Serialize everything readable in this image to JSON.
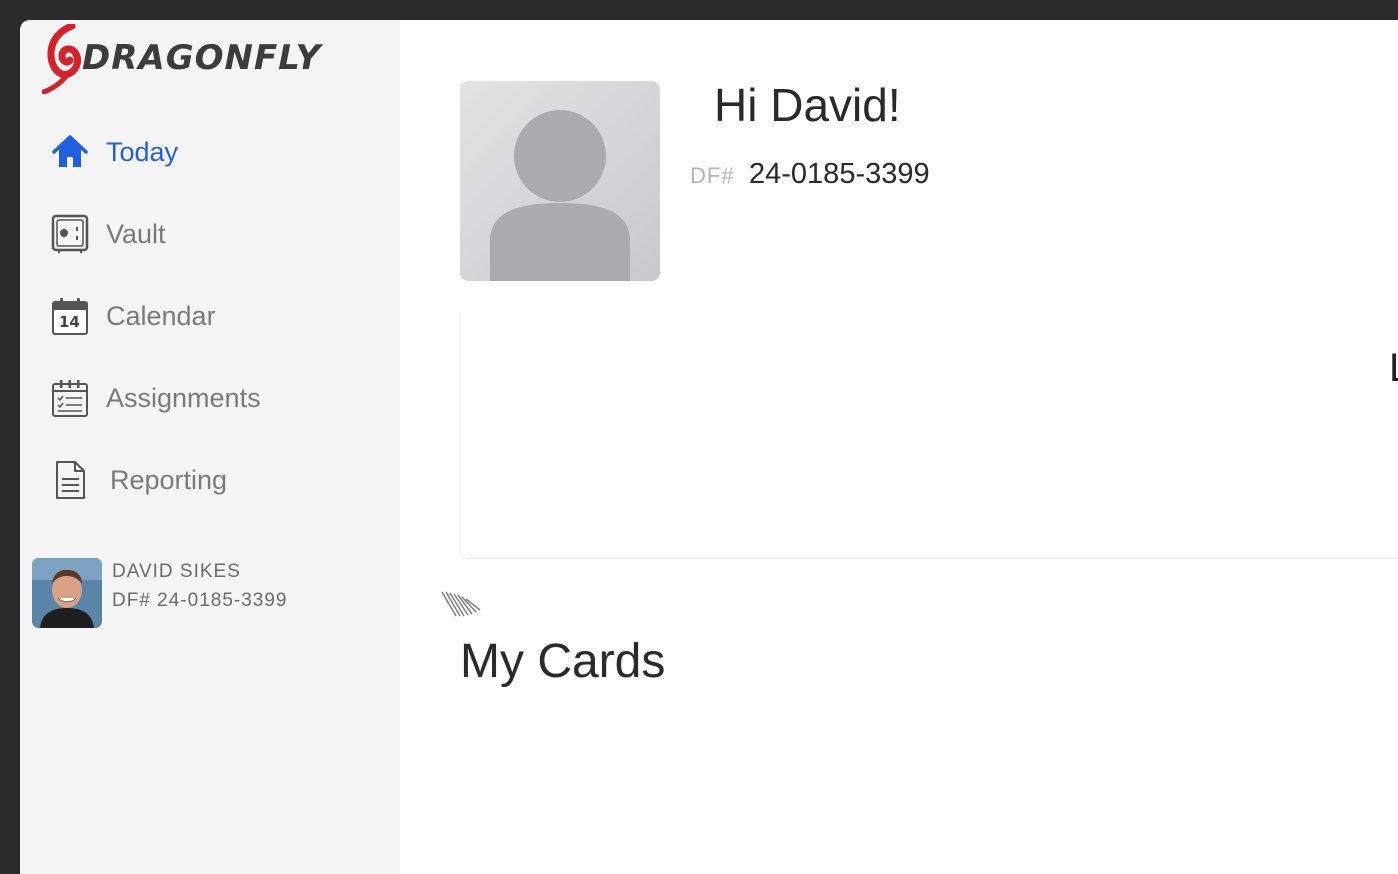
{
  "app": {
    "logo_text": "DRAGONFLY",
    "accent_color": "#2260d8",
    "logo_red": "#d8202a"
  },
  "sidebar": {
    "items": [
      {
        "label": "Today",
        "icon": "home-icon",
        "active": true
      },
      {
        "label": "Vault",
        "icon": "vault-icon",
        "active": false
      },
      {
        "label": "Calendar",
        "icon": "calendar-icon",
        "active": false,
        "icon_text": "14"
      },
      {
        "label": "Assignments",
        "icon": "assignments-icon",
        "active": false
      },
      {
        "label": "Reporting",
        "icon": "document-icon",
        "active": false
      }
    ],
    "user": {
      "name": "DAVID SIKES",
      "df": "DF# 24-0185-3399"
    }
  },
  "main": {
    "greeting": "Hi David!",
    "df_prefix": "DF#",
    "df_number": "24-0185-3399",
    "panel_edge_letter": "L",
    "section_title": "My Cards"
  }
}
